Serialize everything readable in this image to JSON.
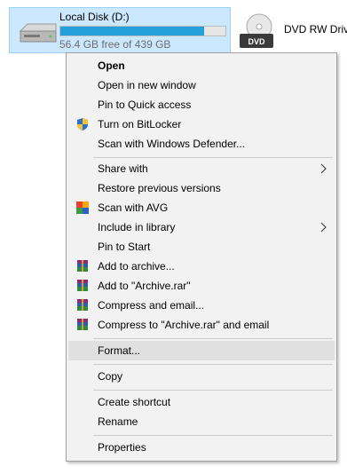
{
  "drives": {
    "local": {
      "title": "Local Disk (D:)",
      "free_text": "56.4 GB free of 439 GB",
      "used_fraction": 0.87
    },
    "dvd": {
      "title": "DVD RW Drive",
      "badge": "DVD"
    }
  },
  "menu": {
    "open": "Open",
    "open_new_window": "Open in new window",
    "pin_quick_access": "Pin to Quick access",
    "bitlocker": "Turn on BitLocker",
    "defender": "Scan with Windows Defender...",
    "share_with": "Share with",
    "restore_versions": "Restore previous versions",
    "scan_avg": "Scan with AVG",
    "include_library": "Include in library",
    "pin_start": "Pin to Start",
    "add_archive": "Add to archive...",
    "add_archive_rar": "Add to \"Archive.rar\"",
    "compress_email": "Compress and email...",
    "compress_rar_email": "Compress to \"Archive.rar\" and email",
    "format": "Format...",
    "copy": "Copy",
    "create_shortcut": "Create shortcut",
    "rename": "Rename",
    "properties": "Properties"
  },
  "colors": {
    "selection_bg": "#cce8ff",
    "capacity_fill": "#26a0da",
    "menu_bg": "#f2f2f2",
    "menu_highlight": "#e0e0e0"
  },
  "icons": [
    "hard-drive-icon",
    "dvd-drive-icon",
    "shield-icon",
    "avg-icon",
    "winrar-icon",
    "chevron-right-icon"
  ]
}
